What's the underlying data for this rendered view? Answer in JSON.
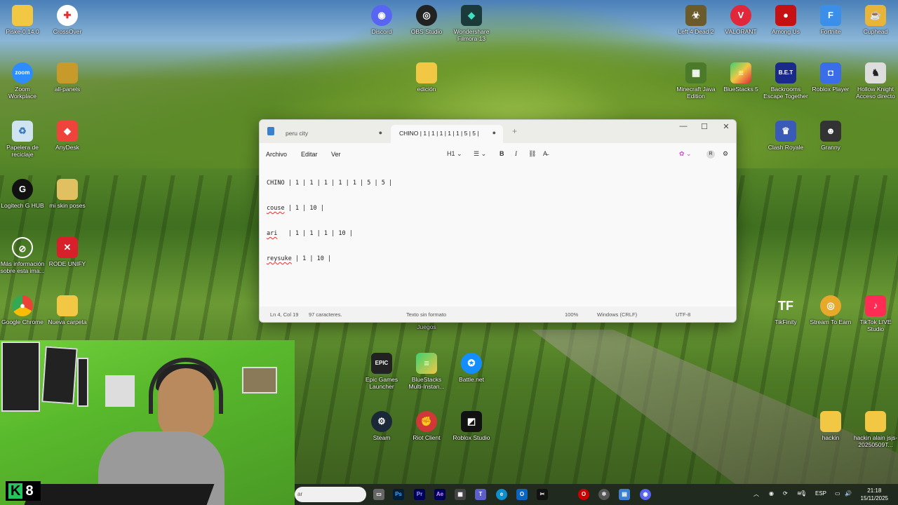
{
  "desktop_icons": [
    {
      "label": "Piske-0.14.0"
    },
    {
      "label": "CrossOver"
    },
    {
      "label": "Discord"
    },
    {
      "label": "OBS Studio"
    },
    {
      "label": "Wondershare Filmora 13"
    },
    {
      "label": "Left 4 Dead 2"
    },
    {
      "label": "VALORANT"
    },
    {
      "label": "Among Us"
    },
    {
      "label": "Fortnite"
    },
    {
      "label": "Cuphead"
    },
    {
      "label": "Zoom Workplace"
    },
    {
      "label": "all-panels"
    },
    {
      "label": "edición"
    },
    {
      "label": "Minecraft Java Edition"
    },
    {
      "label": "BlueStacks 5"
    },
    {
      "label": "Backrooms Escape Together"
    },
    {
      "label": "Roblox Player"
    },
    {
      "label": "Hollow Knight Acceso directo"
    },
    {
      "label": "Papelera de reciclaje"
    },
    {
      "label": "AnyDesk"
    },
    {
      "label": "Clash Royale"
    },
    {
      "label": "Granny"
    },
    {
      "label": "Logitech G HUB"
    },
    {
      "label": "mi skin poses"
    },
    {
      "label": "Más información sobre esta ima..."
    },
    {
      "label": "RODE UNIFY"
    },
    {
      "label": "Google Chrome"
    },
    {
      "label": "Nueva carpeta"
    },
    {
      "label": "TikFinity"
    },
    {
      "label": "Stream To Earn"
    },
    {
      "label": "TikTok LIVE Studio"
    },
    {
      "label": "Juegos"
    },
    {
      "label": "Epic Games Launcher"
    },
    {
      "label": "BlueStacks Multi-Instan..."
    },
    {
      "label": "Battle.net"
    },
    {
      "label": "Steam"
    },
    {
      "label": "Riot Client"
    },
    {
      "label": "Roblox Studio"
    },
    {
      "label": "hackin"
    },
    {
      "label": "hackin alain jsjs-20250509T..."
    }
  ],
  "notepad": {
    "tabs": [
      {
        "label": "peru city"
      },
      {
        "label": "CHINO | 1 | 1 | 1 | 1 | 1 | 5 | 5 |"
      }
    ],
    "new_tab": "+",
    "window_buttons": {
      "minimize": "—",
      "maximize": "☐",
      "close": "✕"
    },
    "menu": {
      "file": "Archivo",
      "edit": "Editar",
      "view": "Ver"
    },
    "toolbar": {
      "heading": "H1",
      "list": "☰",
      "bold": "B",
      "italic": "I",
      "link": "⛓",
      "clear": "A̶",
      "settings": "⚙",
      "account": "R"
    },
    "lines": [
      {
        "name": "CHINO",
        "rest": " | 1 | 1 | 1 | 1 | 1 | 5 | 5 |"
      },
      {
        "name": "couse",
        "rest": " | 1 | 10 |"
      },
      {
        "name": "ari",
        "rest": "   | 1 | 1 | 1 | 10 |"
      },
      {
        "name": "reysuke",
        "rest": " | 1 | 10 |"
      }
    ],
    "status": {
      "position": "Ln 4, Col 19",
      "chars": "97 caracteres.",
      "format": "Texto sin formato",
      "zoom": "100%",
      "line_ending": "Windows (CRLF)",
      "encoding": "UTF-8"
    }
  },
  "webcam": {
    "overlay": "8"
  },
  "taskbar": {
    "search_placeholder": "ar",
    "tray_lang": "ESP",
    "time": "21:18",
    "date": "15/11/2025",
    "apps": [
      "Ps",
      "Pr",
      "Ae"
    ]
  }
}
